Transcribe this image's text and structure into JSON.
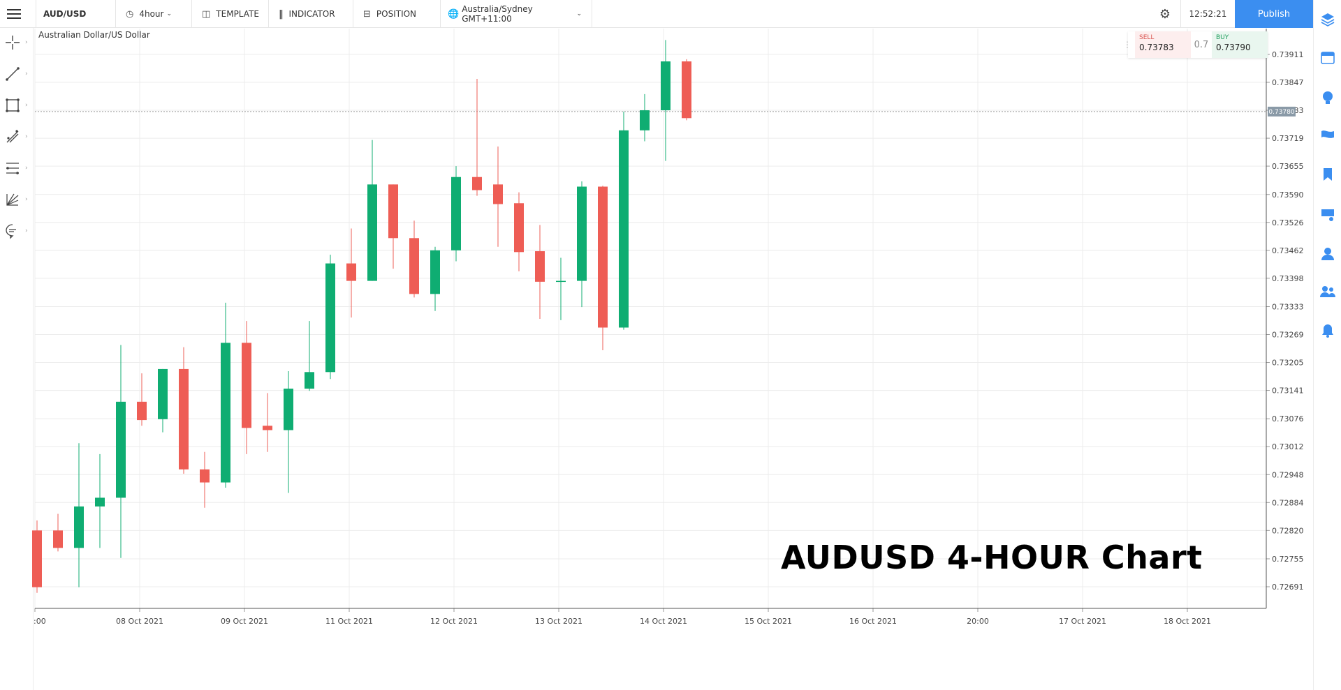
{
  "toolbar": {
    "symbol": "AUD/USD",
    "interval": "4hour",
    "template": "TEMPLATE",
    "indicator": "INDICATOR",
    "position": "POSITION",
    "timezone": "Australia/Sydney GMT+11:00",
    "clock": "12:52:21",
    "publish": "Publish"
  },
  "chart_title": "Australian Dollar/US Dollar",
  "trade": {
    "sell_label": "SELL",
    "sell_price": "0.73783",
    "spread": "0.7",
    "buy_label": "BUY",
    "buy_price": "0.73790"
  },
  "watermark": "AUDUSD 4-HOUR Chart",
  "colors": {
    "up": "#0fad72",
    "down": "#ee5d55",
    "grid": "#ececec",
    "accent": "#3b8ef0"
  },
  "icons": {
    "left_tools": [
      "crosshair-icon",
      "trend-line-icon",
      "rectangle-icon",
      "pen-icon",
      "fibonacci-icon",
      "gann-icon",
      "comment-icon"
    ],
    "right_tools": [
      "layers-icon",
      "calendar-icon",
      "idea-icon",
      "news-icon",
      "bookmark-icon",
      "screen-icon",
      "profile-icon",
      "users-icon",
      "bell-icon"
    ]
  },
  "chart_data": {
    "type": "candlestick",
    "title": "Australian Dollar/US Dollar",
    "ylim": [
      0.7263,
      0.7396
    ],
    "y_ticks": [
      "0.73911",
      "0.73847",
      "0.73783",
      "0.73719",
      "0.73655",
      "0.73590",
      "0.73526",
      "0.73462",
      "0.73398",
      "0.73333",
      "0.73269",
      "0.73205",
      "0.73141",
      "0.73076",
      "0.73012",
      "0.72948",
      "0.72884",
      "0.72820",
      "0.72755",
      "0.72691"
    ],
    "x_labels": [
      ":00",
      "08 Oct 2021",
      "09 Oct 2021",
      "11 Oct 2021",
      "12 Oct 2021",
      "13 Oct 2021",
      "14 Oct 2021",
      "15 Oct 2021",
      "16 Oct 2021",
      "20:00",
      "17 Oct 2021",
      "18 Oct 2021"
    ],
    "current_price": "0.73780",
    "candles": [
      {
        "o": 0.7282,
        "h": 0.72843,
        "l": 0.72677,
        "c": 0.7269
      },
      {
        "o": 0.7282,
        "h": 0.72858,
        "l": 0.72772,
        "c": 0.7278
      },
      {
        "o": 0.7278,
        "h": 0.7302,
        "l": 0.7269,
        "c": 0.72875
      },
      {
        "o": 0.72875,
        "h": 0.72995,
        "l": 0.7278,
        "c": 0.72895
      },
      {
        "o": 0.72895,
        "h": 0.73245,
        "l": 0.72757,
        "c": 0.73115
      },
      {
        "o": 0.73115,
        "h": 0.7318,
        "l": 0.7306,
        "c": 0.73073
      },
      {
        "o": 0.73075,
        "h": 0.7319,
        "l": 0.73045,
        "c": 0.7319
      },
      {
        "o": 0.7319,
        "h": 0.7324,
        "l": 0.7295,
        "c": 0.7296
      },
      {
        "o": 0.7296,
        "h": 0.73,
        "l": 0.72872,
        "c": 0.7293
      },
      {
        "o": 0.7293,
        "h": 0.73342,
        "l": 0.72918,
        "c": 0.7325
      },
      {
        "o": 0.7325,
        "h": 0.733,
        "l": 0.72995,
        "c": 0.73055
      },
      {
        "o": 0.7306,
        "h": 0.73135,
        "l": 0.73,
        "c": 0.7305
      },
      {
        "o": 0.7305,
        "h": 0.73185,
        "l": 0.72906,
        "c": 0.73145
      },
      {
        "o": 0.73145,
        "h": 0.733,
        "l": 0.7314,
        "c": 0.73183
      },
      {
        "o": 0.73183,
        "h": 0.73452,
        "l": 0.73167,
        "c": 0.73432
      },
      {
        "o": 0.73432,
        "h": 0.73512,
        "l": 0.73308,
        "c": 0.73392
      },
      {
        "o": 0.73392,
        "h": 0.73715,
        "l": 0.73392,
        "c": 0.73613
      },
      {
        "o": 0.73613,
        "h": 0.73613,
        "l": 0.7342,
        "c": 0.7349
      },
      {
        "o": 0.7349,
        "h": 0.7353,
        "l": 0.73354,
        "c": 0.73362
      },
      {
        "o": 0.73362,
        "h": 0.7347,
        "l": 0.73323,
        "c": 0.73462
      },
      {
        "o": 0.73462,
        "h": 0.73655,
        "l": 0.73437,
        "c": 0.7363
      },
      {
        "o": 0.7363,
        "h": 0.73855,
        "l": 0.73587,
        "c": 0.736
      },
      {
        "o": 0.73613,
        "h": 0.737,
        "l": 0.7347,
        "c": 0.73568
      },
      {
        "o": 0.7357,
        "h": 0.73595,
        "l": 0.73414,
        "c": 0.73458
      },
      {
        "o": 0.7346,
        "h": 0.7352,
        "l": 0.73305,
        "c": 0.7339
      },
      {
        "o": 0.7339,
        "h": 0.73445,
        "l": 0.73302,
        "c": 0.73392
      },
      {
        "o": 0.73392,
        "h": 0.7362,
        "l": 0.73332,
        "c": 0.73608
      },
      {
        "o": 0.73608,
        "h": 0.7361,
        "l": 0.73233,
        "c": 0.73285
      },
      {
        "o": 0.73285,
        "h": 0.7378,
        "l": 0.7328,
        "c": 0.73737
      },
      {
        "o": 0.73737,
        "h": 0.7382,
        "l": 0.73712,
        "c": 0.73783
      },
      {
        "o": 0.73783,
        "h": 0.73944,
        "l": 0.73667,
        "c": 0.73895
      },
      {
        "o": 0.73895,
        "h": 0.739,
        "l": 0.7376,
        "c": 0.73765
      }
    ]
  }
}
